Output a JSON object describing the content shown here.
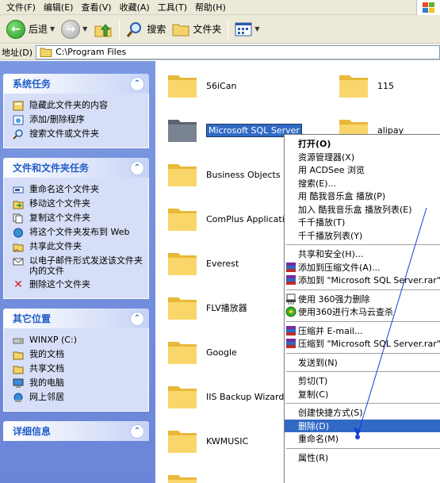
{
  "menubar": {
    "items": [
      "文件(F)",
      "编辑(E)",
      "查看(V)",
      "收藏(A)",
      "工具(T)",
      "帮助(H)"
    ]
  },
  "toolbar": {
    "back_label": "后退",
    "search_label": "搜索",
    "folders_label": "文件夹"
  },
  "address": {
    "label": "地址(D)",
    "value": "C:\\Program Files"
  },
  "taskpane": {
    "system_tasks": {
      "title": "系统任务",
      "items": [
        "隐藏此文件夹的内容",
        "添加/删除程序",
        "搜索文件或文件夹"
      ]
    },
    "file_tasks": {
      "title": "文件和文件夹任务",
      "items": [
        "重命名这个文件夹",
        "移动这个文件夹",
        "复制这个文件夹",
        "将这个文件夹发布到 Web",
        "共享此文件夹",
        "以电子邮件形式发送该文件夹内的文件",
        "删除这个文件夹"
      ]
    },
    "other_places": {
      "title": "其它位置",
      "items": [
        "WINXP (C:)",
        "我的文档",
        "共享文档",
        "我的电脑",
        "网上邻居"
      ]
    },
    "details": {
      "title": "详细信息"
    }
  },
  "files": {
    "left_column": [
      "56iCan",
      "Microsoft SQL Server",
      "Business Objects",
      "ComPlus Applications",
      "Everest",
      "FLV播放器",
      "Google",
      "IIS Backup Wizard",
      "KWMUSIC"
    ],
    "right_column": [
      "115",
      "alipay"
    ],
    "selected": "Microsoft SQL Server"
  },
  "context_menu": {
    "open": "打开(O)",
    "explorer": "资源管理器(X)",
    "acdsee": "用 ACDSee 浏览",
    "search": "搜索(E)...",
    "kuwo_play": "用 酷我音乐盒 播放(P)",
    "kuwo_add": "加入 酷我音乐盒 播放列表(E)",
    "qianqian_play": "千千播放(T)",
    "qianqian_list": "千千播放列表(Y)",
    "share": "共享和安全(H)...",
    "add_archive": "添加到压缩文件(A)...",
    "add_rar": "添加到 \"Microsoft SQL Server.rar\"(T)",
    "force_delete": "使用 360强力删除",
    "trojan_scan": "使用360进行木马云查杀",
    "compress_email": "压缩并 E-mail...",
    "compress_rar_email": "压缩到 \"Microsoft SQL Server.rar\" 并",
    "send_to": "发送到(N)",
    "cut": "剪切(T)",
    "copy": "复制(C)",
    "create_shortcut": "创建快捷方式(S)",
    "delete": "删除(D)",
    "rename": "重命名(M)",
    "properties": "属性(R)"
  },
  "colors": {
    "selection": "#316ac5",
    "taskpane": "#7a98e1",
    "folder": "#f4d26b",
    "arrow": "#1a3cd8"
  }
}
